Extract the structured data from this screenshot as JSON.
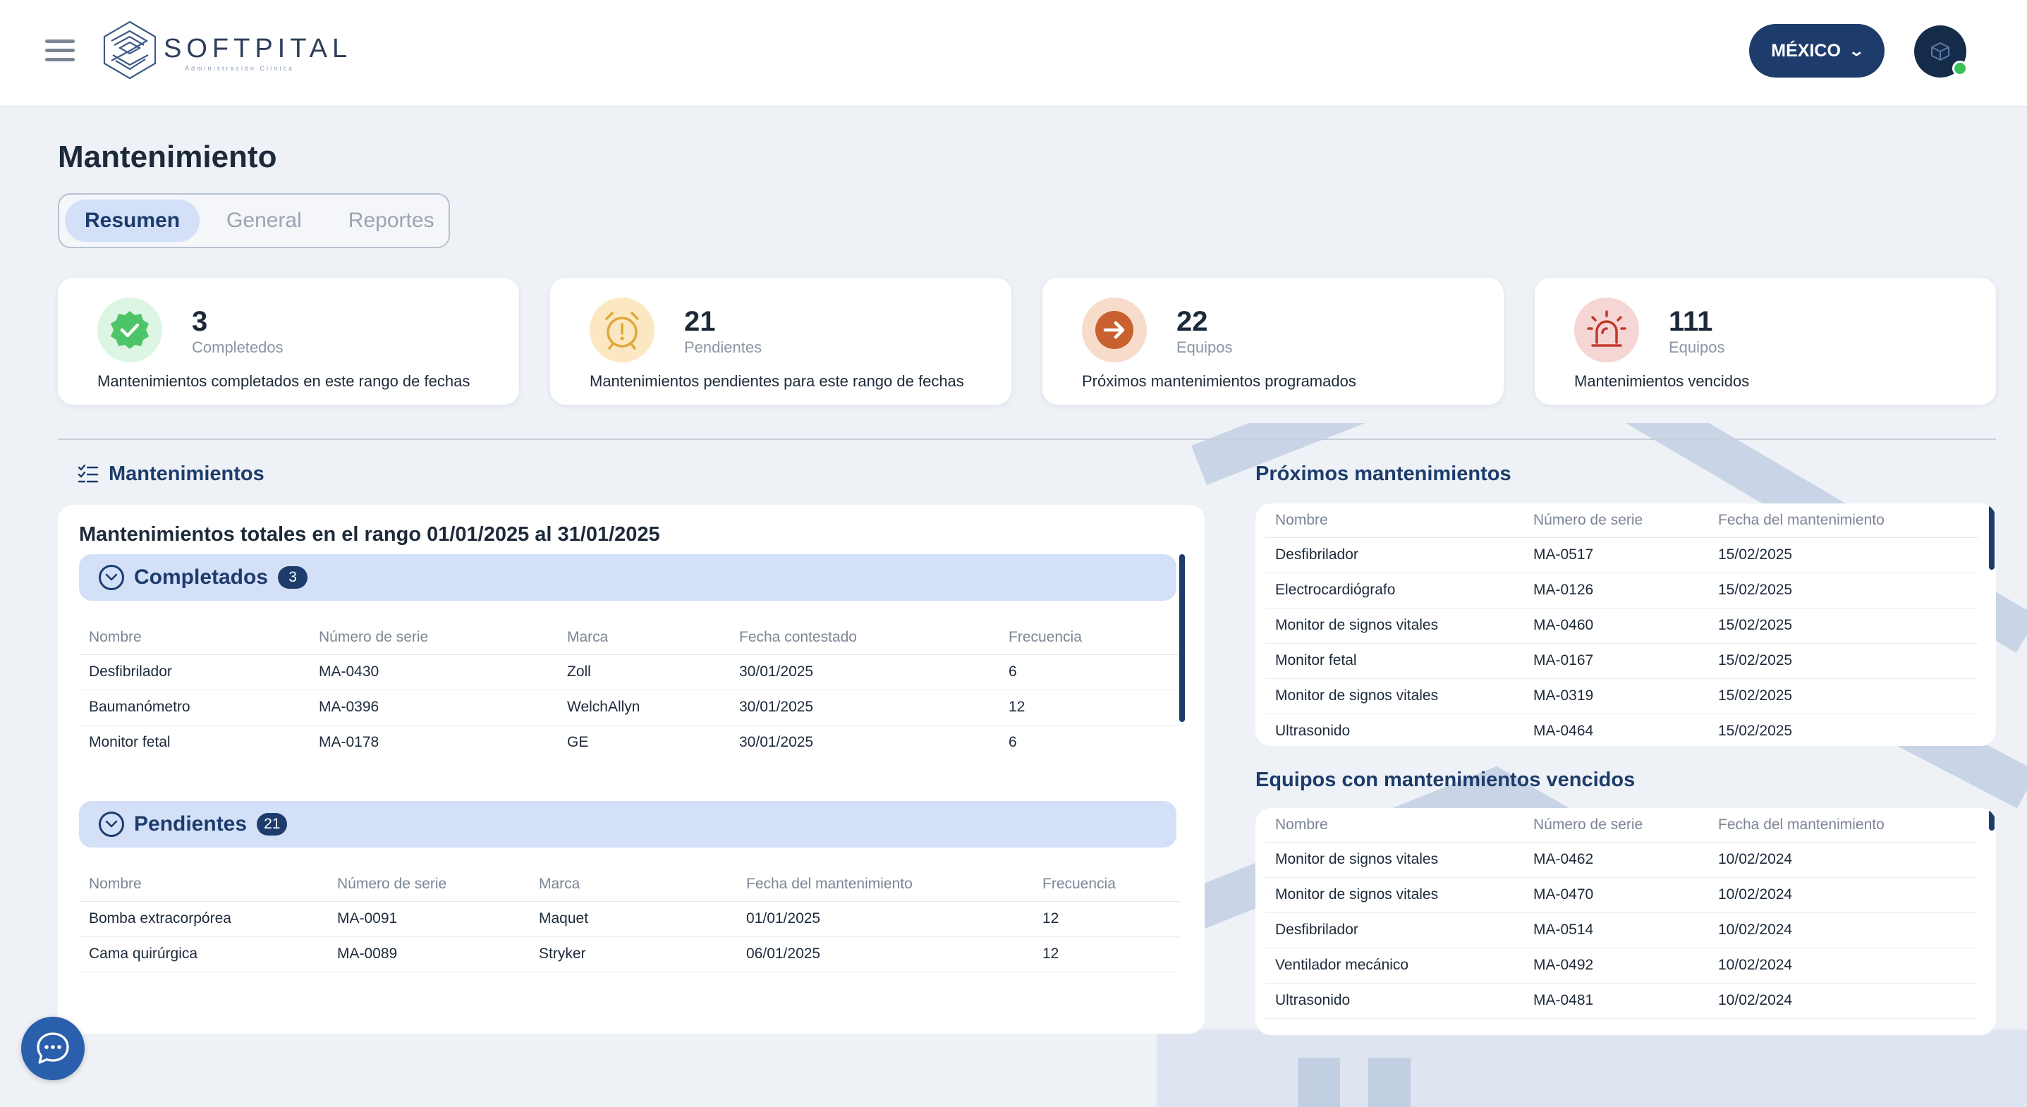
{
  "brand": {
    "name": "SOFTPITAL",
    "tagline": "Administración Clínica"
  },
  "header": {
    "country": "MÉXICO"
  },
  "page": {
    "title": "Mantenimiento"
  },
  "tabs": [
    {
      "label": "Resumen",
      "active": true
    },
    {
      "label": "General",
      "active": false
    },
    {
      "label": "Reportes",
      "active": false
    }
  ],
  "stats": [
    {
      "value": "3",
      "unit": "Completedos",
      "description": "Mantenimientos completados en este rango de fechas",
      "icon": "check-badge-icon",
      "color": "#4cc467"
    },
    {
      "value": "21",
      "unit": "Pendientes",
      "description": "Mantenimientos pendientes para este rango de fechas",
      "icon": "alarm-clock-icon",
      "color": "#e0a83a"
    },
    {
      "value": "22",
      "unit": "Equipos",
      "description": "Próximos mantenimientos programados",
      "icon": "arrow-right-icon",
      "color": "#c8612f"
    },
    {
      "value": "111",
      "unit": "Equipos",
      "description": "Mantenimientos vencidos",
      "icon": "siren-icon",
      "color": "#c0392b"
    }
  ],
  "mantenimientos": {
    "heading": "Mantenimientos",
    "panel_title": "Mantenimientos totales en el rango 01/01/2025 al 31/01/2025",
    "completados": {
      "label": "Completados",
      "count": "3",
      "columns": [
        "Nombre",
        "Número de serie",
        "Marca",
        "Fecha contestado",
        "Frecuencia"
      ],
      "rows": [
        [
          "Desfibrilador",
          "MA-0430",
          "Zoll",
          "30/01/2025",
          "6"
        ],
        [
          "Baumanómetro",
          "MA-0396",
          "WelchAllyn",
          "30/01/2025",
          "12"
        ],
        [
          "Monitor fetal",
          "MA-0178",
          "GE",
          "30/01/2025",
          "6"
        ]
      ]
    },
    "pendientes": {
      "label": "Pendientes",
      "count": "21",
      "columns": [
        "Nombre",
        "Número de serie",
        "Marca",
        "Fecha del mantenimiento",
        "Frecuencia"
      ],
      "rows": [
        [
          "Bomba extracorpórea",
          "MA-0091",
          "Maquet",
          "01/01/2025",
          "12"
        ],
        [
          "Cama quirúrgica",
          "MA-0089",
          "Stryker",
          "06/01/2025",
          "12"
        ]
      ]
    }
  },
  "proximos": {
    "heading": "Próximos mantenimientos",
    "columns": [
      "Nombre",
      "Número de serie",
      "Fecha del mantenimiento"
    ],
    "rows": [
      [
        "Desfibrilador",
        "MA-0517",
        "15/02/2025"
      ],
      [
        "Electrocardiógrafo",
        "MA-0126",
        "15/02/2025"
      ],
      [
        "Monitor de signos vitales",
        "MA-0460",
        "15/02/2025"
      ],
      [
        "Monitor fetal",
        "MA-0167",
        "15/02/2025"
      ],
      [
        "Monitor de signos vitales",
        "MA-0319",
        "15/02/2025"
      ],
      [
        "Ultrasonido",
        "MA-0464",
        "15/02/2025"
      ]
    ]
  },
  "vencidos": {
    "heading": "Equipos con mantenimientos vencidos",
    "columns": [
      "Nombre",
      "Número de serie",
      "Fecha del mantenimiento"
    ],
    "rows": [
      [
        "Monitor de signos vitales",
        "MA-0462",
        "10/02/2024"
      ],
      [
        "Monitor de signos vitales",
        "MA-0470",
        "10/02/2024"
      ],
      [
        "Desfibrilador",
        "MA-0514",
        "10/02/2024"
      ],
      [
        "Ventilador mecánico",
        "MA-0492",
        "10/02/2024"
      ],
      [
        "Ultrasonido",
        "MA-0481",
        "10/02/2024"
      ]
    ]
  },
  "colors": {
    "primary": "#1d3c6b",
    "accent_light": "#d3e0f8",
    "background": "#eef2f7"
  }
}
